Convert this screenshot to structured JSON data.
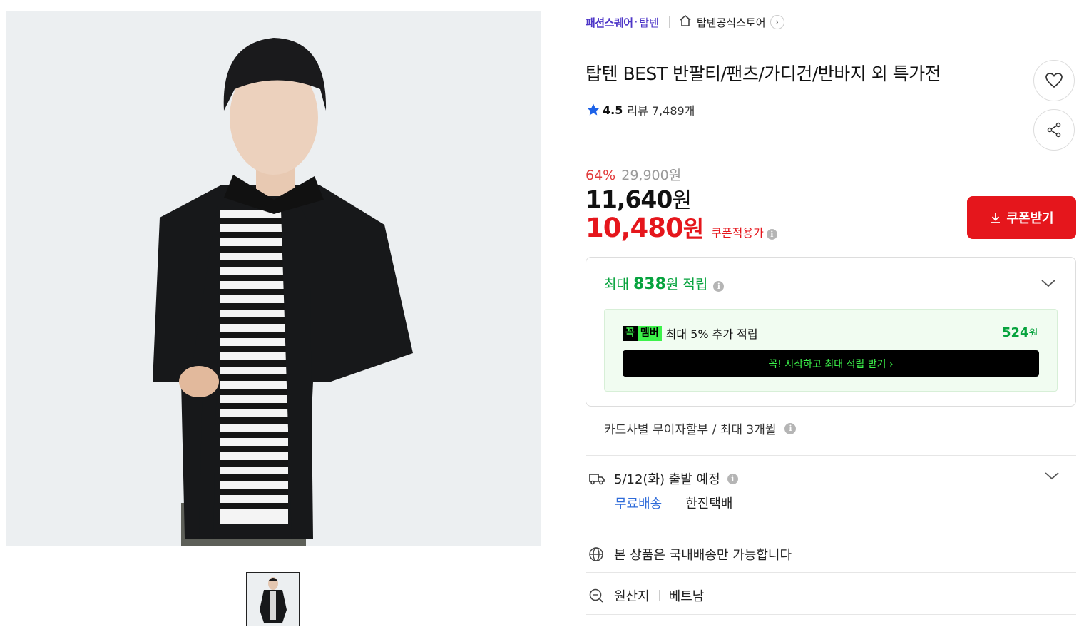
{
  "breadcrumb": {
    "brand": "패션스퀘어",
    "category": "탑텐",
    "store": "탑텐공식스토어"
  },
  "product": {
    "title": "탑텐 BEST 반팔티/팬츠/가디건/반바지 외 특가전",
    "rating": "4.5",
    "review_label": "리뷰 7,489개",
    "discount_pct": "64%",
    "original_price": "29,900원",
    "price": "11,640",
    "price_unit": "원",
    "coupon_price": "10,480",
    "coupon_unit": "원",
    "coupon_label": "쿠폰적용가",
    "coupon_button": "쿠폰받기"
  },
  "points": {
    "prefix": "최대",
    "amount": "838",
    "suffix": "원 적립",
    "member_badge_1": "꼭",
    "member_badge_2": "멤버",
    "member_text": "최대 5% 추가 적립",
    "member_amount": "524",
    "member_unit": "원",
    "join_button": "꼭! 시작하고 최대 적립 받기 ›"
  },
  "installment": "카드사별 무이자할부 / 최대 3개월",
  "shipping": {
    "date": "5/12(화) 출발 예정",
    "fee": "무료배송",
    "courier": "한진택배"
  },
  "domestic": "본 상품은 국내배송만 가능합니다",
  "origin": {
    "label": "원산지",
    "value": "베트남"
  },
  "colors": {
    "accent_red": "#e5161c",
    "point_green": "#07a33e",
    "brand_purple": "#4e37c8",
    "link_blue": "#2e6bd9"
  }
}
